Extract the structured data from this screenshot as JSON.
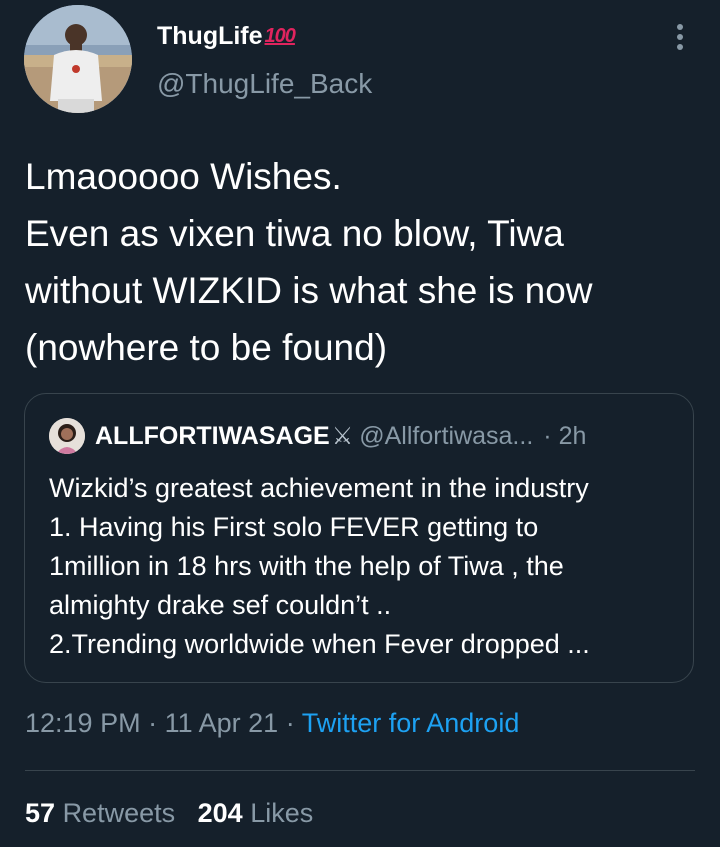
{
  "author": {
    "display_name": "ThugLife",
    "name_emoji": "100",
    "handle": "@ThugLife_Back"
  },
  "tweet": {
    "lines": [
      "Lmaooooo Wishes.",
      "Even as vixen tiwa no blow, Tiwa",
      "without WIZKID is what she is now",
      "(nowhere to be found)"
    ]
  },
  "quoted": {
    "name": "ALLFORTIWASAGE",
    "name_emoji": "⚔",
    "handle": "@Allfortiwasa...",
    "separator": "·",
    "time": "2h",
    "lines": [
      "Wizkid’s greatest achievement in the industry",
      "1. Having his First solo FEVER getting to",
      "1million in 18 hrs with the help of Tiwa , the",
      "almighty drake sef couldn’t ..",
      "2.Trending worldwide when Fever dropped ..."
    ]
  },
  "meta": {
    "time": "12:19 PM",
    "sep1": "·",
    "date": "11 Apr 21",
    "sep2": "·",
    "source": "Twitter for Android"
  },
  "stats": {
    "retweets_count": "57",
    "retweets_label": "Retweets",
    "likes_count": "204",
    "likes_label": "Likes"
  },
  "colors": {
    "background": "#15202b",
    "secondary_text": "#8899a6",
    "link": "#1da1f2",
    "border": "#38444d"
  },
  "icons": {
    "more": "vertical-ellipsis-icon"
  }
}
